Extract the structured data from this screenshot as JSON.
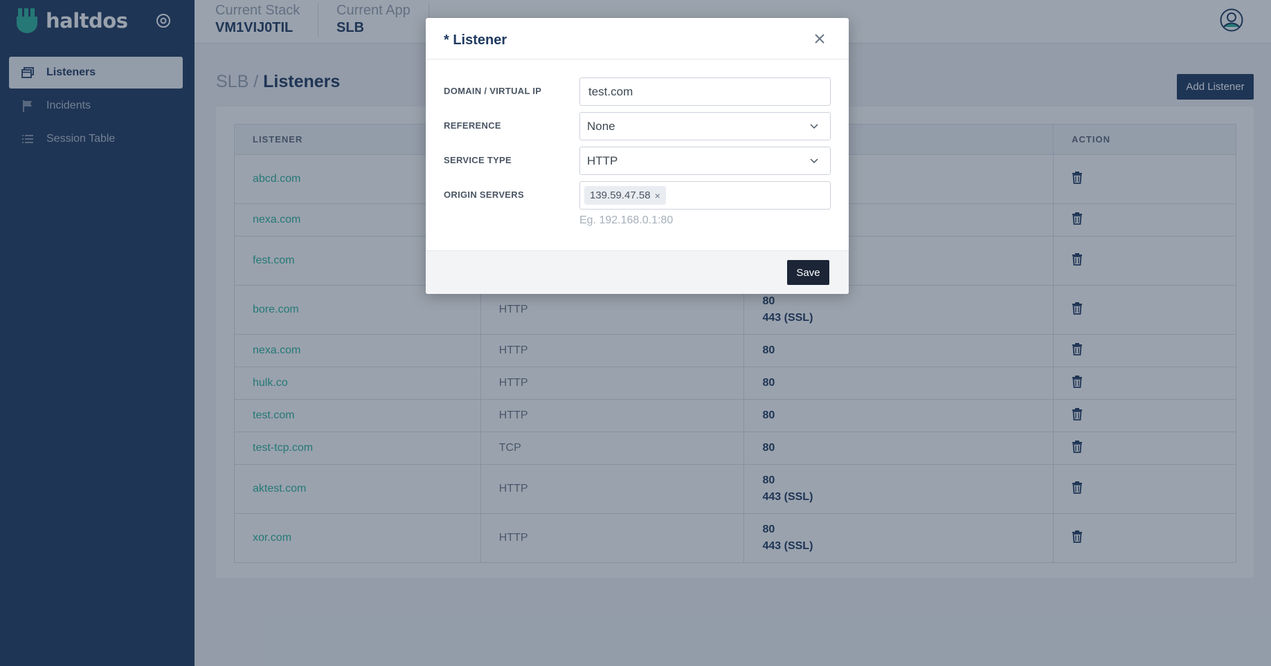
{
  "brand": {
    "name": "haltdos",
    "color": "#2bb39b"
  },
  "sidebar": {
    "items": [
      {
        "label": "Listeners",
        "icon": "window-icon",
        "active": true
      },
      {
        "label": "Incidents",
        "icon": "flag-icon",
        "active": false
      },
      {
        "label": "Session Table",
        "icon": "list-icon",
        "active": false
      }
    ]
  },
  "topbar": {
    "stack_label": "Current Stack",
    "stack_value": "VM1VIJ0TIL",
    "app_label": "Current App",
    "app_value": "SLB"
  },
  "breadcrumb": {
    "parent": "SLB",
    "separator": "/",
    "current": "Listeners"
  },
  "add_button_label": "Add Listener",
  "table": {
    "headers": {
      "listener": "LISTENER",
      "type": "",
      "ports": "",
      "action": "ACTION"
    },
    "rows": [
      {
        "listener": "abcd.com",
        "type": "",
        "port1": "",
        "port2": ""
      },
      {
        "listener": "nexa.com",
        "type": "",
        "port1": "",
        "port2": ""
      },
      {
        "listener": "fest.com",
        "type": "",
        "port1": "",
        "port2": ""
      },
      {
        "listener": "bore.com",
        "type": "HTTP",
        "port1": "80",
        "port2": "443 (SSL)"
      },
      {
        "listener": "nexa.com",
        "type": "HTTP",
        "port1": "80",
        "port2": ""
      },
      {
        "listener": "hulk.co",
        "type": "HTTP",
        "port1": "80",
        "port2": ""
      },
      {
        "listener": "test.com",
        "type": "HTTP",
        "port1": "80",
        "port2": ""
      },
      {
        "listener": "test-tcp.com",
        "type": "TCP",
        "port1": "80",
        "port2": ""
      },
      {
        "listener": "aktest.com",
        "type": "HTTP",
        "port1": "80",
        "port2": "443 (SSL)"
      },
      {
        "listener": "xor.com",
        "type": "HTTP",
        "port1": "80",
        "port2": "443 (SSL)"
      }
    ]
  },
  "modal": {
    "title": "* Listener",
    "domain_label": "DOMAIN / VIRTUAL IP",
    "domain_value": "test.com",
    "reference_label": "REFERENCE",
    "reference_value": "None",
    "service_type_label": "SERVICE TYPE",
    "service_type_value": "HTTP",
    "origin_label": "ORIGIN SERVERS",
    "origin_tags": [
      "139.59.47.58"
    ],
    "origin_tag_remove": "×",
    "origin_hint": "Eg. 192.168.0.1:80",
    "save_label": "Save"
  },
  "colors": {
    "sidebar_bg": "#1f3a60",
    "accent": "#2bb39b",
    "primary_button": "#1f3a60",
    "save_button": "#1b2536"
  }
}
